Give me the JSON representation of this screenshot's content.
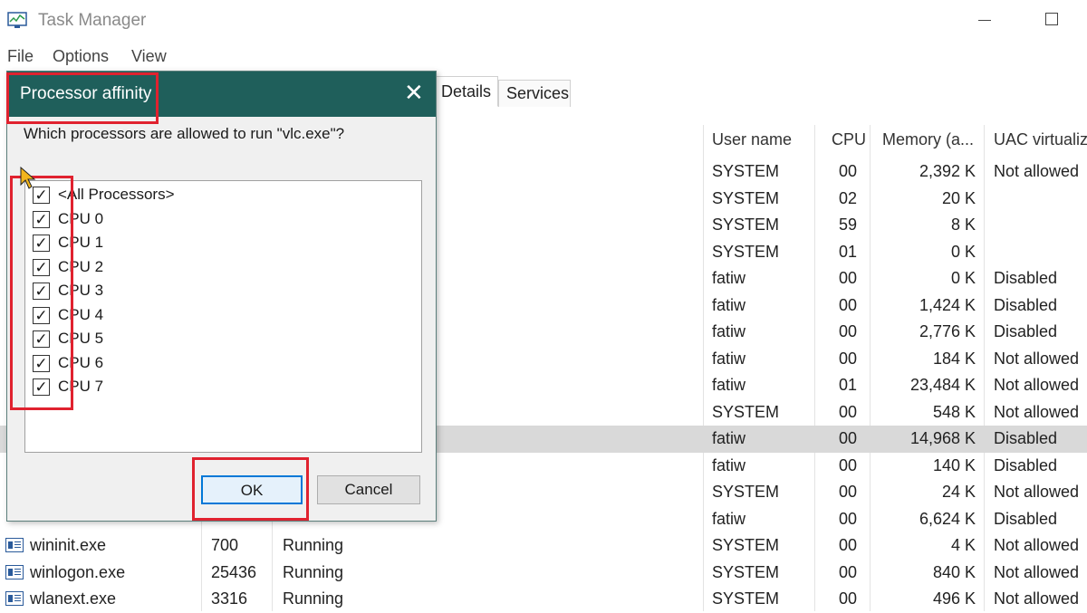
{
  "window": {
    "title": "Task Manager"
  },
  "menu": [
    "File",
    "Options",
    "View"
  ],
  "tabs": {
    "details": "Details",
    "services": "Services"
  },
  "columns": {
    "user": "User name",
    "cpu": "CPU",
    "memory": "Memory (a...",
    "uac": "UAC virtualiz"
  },
  "rows": [
    {
      "user": "SYSTEM",
      "cpu": "00",
      "mem": "2,392 K",
      "uac": "Not allowed"
    },
    {
      "user": "SYSTEM",
      "cpu": "02",
      "mem": "20 K",
      "uac": ""
    },
    {
      "user": "SYSTEM",
      "cpu": "59",
      "mem": "8 K",
      "uac": ""
    },
    {
      "user": "SYSTEM",
      "cpu": "01",
      "mem": "0 K",
      "uac": ""
    },
    {
      "user": "fatiw",
      "cpu": "00",
      "mem": "0 K",
      "uac": "Disabled"
    },
    {
      "user": "fatiw",
      "cpu": "00",
      "mem": "1,424 K",
      "uac": "Disabled"
    },
    {
      "user": "fatiw",
      "cpu": "00",
      "mem": "2,776 K",
      "uac": "Disabled"
    },
    {
      "user": "fatiw",
      "cpu": "00",
      "mem": "184 K",
      "uac": "Not allowed"
    },
    {
      "user": "fatiw",
      "cpu": "01",
      "mem": "23,484 K",
      "uac": "Not allowed"
    },
    {
      "user": "SYSTEM",
      "cpu": "00",
      "mem": "548 K",
      "uac": "Not allowed"
    },
    {
      "user": "fatiw",
      "cpu": "00",
      "mem": "14,968 K",
      "uac": "Disabled"
    },
    {
      "user": "fatiw",
      "cpu": "00",
      "mem": "140 K",
      "uac": "Disabled"
    },
    {
      "user": "SYSTEM",
      "cpu": "00",
      "mem": "24 K",
      "uac": "Not allowed"
    },
    {
      "user": "fatiw",
      "cpu": "00",
      "mem": "6,624 K",
      "uac": "Disabled"
    },
    {
      "name": "wininit.exe",
      "pid": "700",
      "status": "Running",
      "user": "SYSTEM",
      "cpu": "00",
      "mem": "4 K",
      "uac": "Not allowed"
    },
    {
      "name": "winlogon.exe",
      "pid": "25436",
      "status": "Running",
      "user": "SYSTEM",
      "cpu": "00",
      "mem": "840 K",
      "uac": "Not allowed"
    },
    {
      "name": "wlanext.exe",
      "pid": "3316",
      "status": "Running",
      "user": "SYSTEM",
      "cpu": "00",
      "mem": "496 K",
      "uac": "Not allowed"
    }
  ],
  "dialog": {
    "title": "Processor affinity",
    "question": "Which processors are allowed to run \"vlc.exe\"?",
    "items": [
      "<All Processors>",
      "CPU 0",
      "CPU 1",
      "CPU 2",
      "CPU 3",
      "CPU 4",
      "CPU 5",
      "CPU 6",
      "CPU 7"
    ],
    "checked": "✓",
    "ok": "OK",
    "cancel": "Cancel",
    "close": "✕"
  },
  "colors": {
    "dialog_title_bg": "#1f5f5b",
    "annotation": "#e0222f",
    "selected_row": "#d9d9d9"
  }
}
